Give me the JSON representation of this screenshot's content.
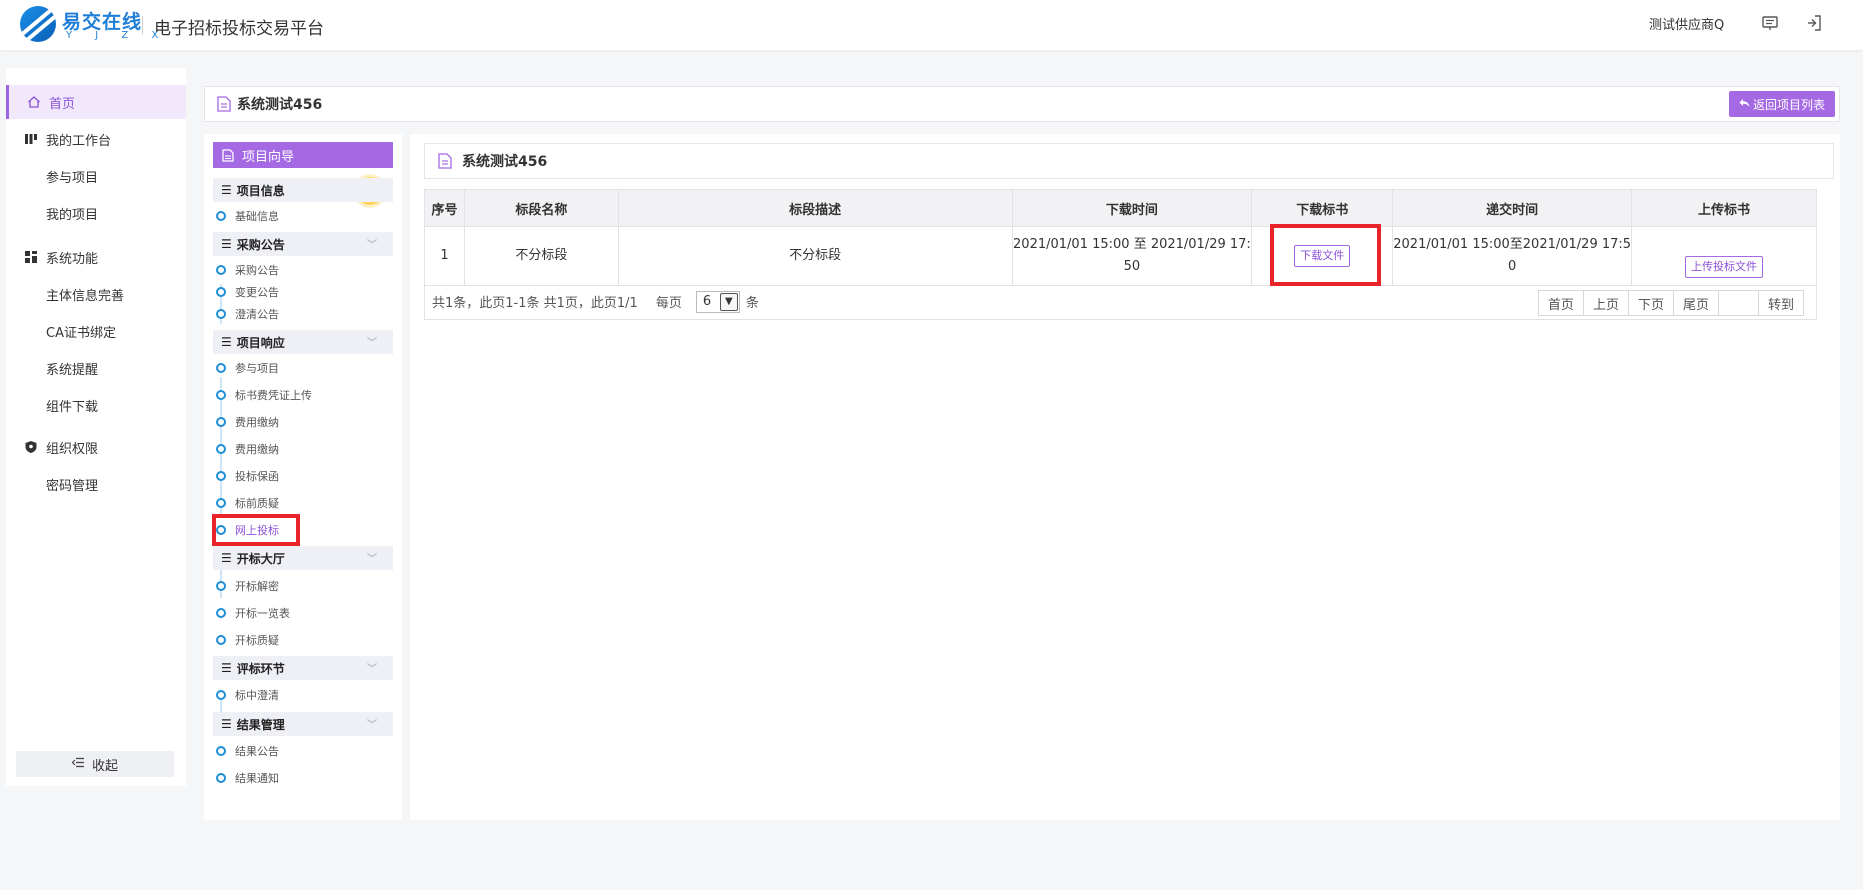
{
  "header": {
    "logo_text": "易交在线",
    "logo_sub": "Y J Z X",
    "platform_title": "电子招标投标交易平台",
    "user_name": "测试供应商Q",
    "icons": [
      "monitor-icon",
      "logout-icon"
    ]
  },
  "leftnav": {
    "items": [
      {
        "label": "首页",
        "icon": "home-icon",
        "active": true
      },
      {
        "label": "我的工作台",
        "icon": "workbench-icon"
      },
      {
        "label": "参与项目",
        "sub": true
      },
      {
        "label": "我的项目",
        "sub": true
      },
      {
        "label": "系统功能",
        "icon": "grid-icon"
      },
      {
        "label": "主体信息完善",
        "sub": true
      },
      {
        "label": "CA证书绑定",
        "sub": true
      },
      {
        "label": "系统提醒",
        "sub": true
      },
      {
        "label": "组件下载",
        "sub": true
      },
      {
        "label": "组织权限",
        "icon": "shield-icon"
      },
      {
        "label": "密码管理",
        "sub": true
      }
    ],
    "collapse_label": "收起"
  },
  "main": {
    "project_title": "系统测试456",
    "return_button": "返回项目列表"
  },
  "guide": {
    "title": "项目向导",
    "sections": [
      {
        "title": "项目信息",
        "steps": [
          "基础信息"
        ]
      },
      {
        "title": "采购公告",
        "steps": [
          "采购公告",
          "变更公告",
          "澄清公告"
        ]
      },
      {
        "title": "项目响应",
        "steps": [
          "参与项目",
          "标书费凭证上传",
          "费用缴纳",
          "费用缴纳",
          "投标保函",
          "标前质疑",
          "网上投标"
        ]
      },
      {
        "title": "开标大厅",
        "steps": [
          "开标解密",
          "开标一览表",
          "开标质疑"
        ]
      },
      {
        "title": "评标环节",
        "steps": [
          "标中澄清"
        ]
      },
      {
        "title": "结果管理",
        "steps": [
          "结果公告",
          "结果通知"
        ]
      }
    ],
    "current_step": "网上投标"
  },
  "content": {
    "title": "系统测试456",
    "table": {
      "headers": [
        "序号",
        "标段名称",
        "标段描述",
        "下载时间",
        "下载标书",
        "递交时间",
        "上传标书"
      ],
      "rows": [
        {
          "index": "1",
          "name": "不分标段",
          "desc": "不分标段",
          "download_time_line1": "2021/01/01 15:00 至 2021/01/29 17:",
          "download_time_line2": "50",
          "download_button": "下载文件",
          "submit_time_line1": "2021/01/01 15:00至2021/01/29 17:5",
          "submit_time_line2": "0",
          "upload_button": "上传投标文件"
        }
      ]
    },
    "pager": {
      "info": "共1条，此页1-1条 共1页，此页1/1",
      "per_page_label": "每页",
      "per_page_value": "6",
      "per_page_unit": "条",
      "buttons": [
        "首页",
        "上页",
        "下页",
        "尾页"
      ],
      "goto_label": "转到"
    }
  },
  "colors": {
    "accent": "#a56ae3",
    "accent_text": "#8c52d9",
    "highlight_red": "#e8232a",
    "step_blue": "#1d8ed8"
  }
}
